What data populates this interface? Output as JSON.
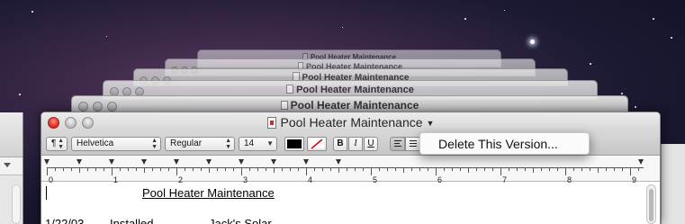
{
  "versions_stack": {
    "title": "Pool Heater Maintenance"
  },
  "window": {
    "title": "Pool Heater Maintenance"
  },
  "toolbar": {
    "paragraph_style": "¶",
    "font_family": "Helvetica",
    "font_style": "Regular",
    "font_size": "14",
    "text_color": "#000000",
    "bold_label": "B",
    "italic_label": "I",
    "underline_label": "U"
  },
  "ruler": {
    "numbers": [
      "0",
      "1",
      "2",
      "3",
      "4",
      "5",
      "6",
      "7",
      "8",
      "9"
    ]
  },
  "document": {
    "heading": "Pool Heater Maintenance",
    "row1": {
      "date": "1/22/03",
      "action": "Installed",
      "vendor": "Jack's Solar"
    }
  },
  "popup": {
    "item": "Delete This Version..."
  }
}
